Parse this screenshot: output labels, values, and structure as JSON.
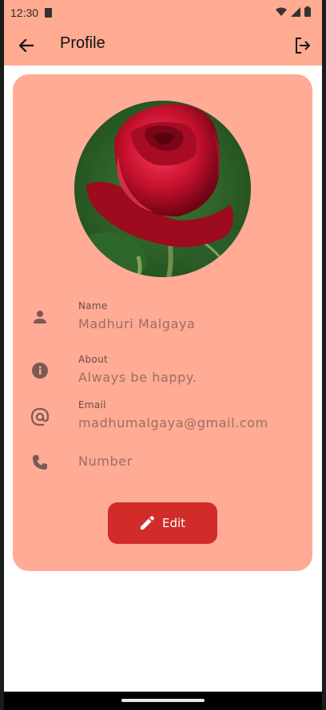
{
  "status_bar": {
    "time": "12:30"
  },
  "app_bar": {
    "title": "Profile"
  },
  "profile": {
    "fields": [
      {
        "label": "Name",
        "value": "Madhuri Malgaya",
        "icon": "person-icon"
      },
      {
        "label": "About",
        "value": "Always be happy.",
        "icon": "info-icon"
      },
      {
        "label": "Email",
        "value": "madhumalgaya@gmail.com",
        "icon": "at-icon"
      },
      {
        "label": "",
        "value": "Number",
        "icon": "phone-icon"
      }
    ],
    "edit_label": "Edit"
  },
  "colors": {
    "app_bar": "#ffab91",
    "card": "#ffab96",
    "edit_button": "#d12c2a"
  }
}
